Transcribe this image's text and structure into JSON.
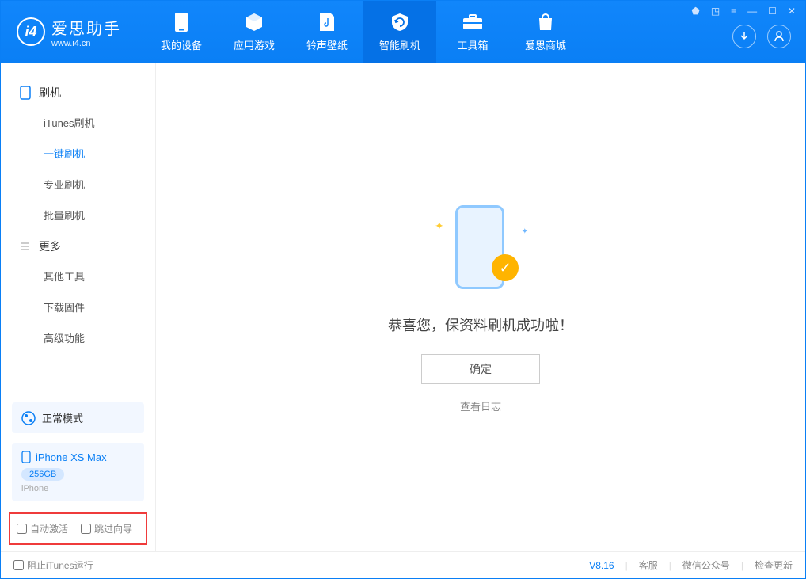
{
  "app": {
    "name": "爱思助手",
    "url": "www.i4.cn"
  },
  "titlebar": {
    "shirt": "⬟",
    "cube": "◳",
    "list": "≡",
    "min": "—",
    "max": "☐",
    "close": "✕"
  },
  "tabs": [
    {
      "label": "我的设备"
    },
    {
      "label": "应用游戏"
    },
    {
      "label": "铃声壁纸"
    },
    {
      "label": "智能刷机"
    },
    {
      "label": "工具箱"
    },
    {
      "label": "爱思商城"
    }
  ],
  "sidebar": {
    "section1": "刷机",
    "items1": [
      "iTunes刷机",
      "一键刷机",
      "专业刷机",
      "批量刷机"
    ],
    "section2": "更多",
    "items2": [
      "其他工具",
      "下载固件",
      "高级功能"
    ]
  },
  "mode": {
    "label": "正常模式"
  },
  "device": {
    "name": "iPhone XS Max",
    "storage": "256GB",
    "type": "iPhone"
  },
  "checks": {
    "auto_activate": "自动激活",
    "skip_guide": "跳过向导"
  },
  "main": {
    "success_text": "恭喜您，保资料刷机成功啦！",
    "ok_button": "确定",
    "view_log": "查看日志"
  },
  "footer": {
    "block_itunes": "阻止iTunes运行",
    "version": "V8.16",
    "support": "客服",
    "wechat": "微信公众号",
    "update": "检查更新"
  }
}
